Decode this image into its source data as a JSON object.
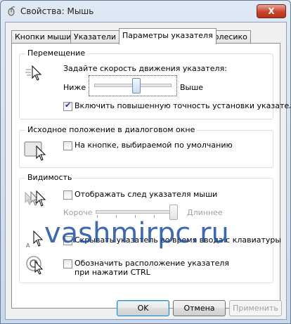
{
  "window": {
    "title": "Свойства: Мышь",
    "close_symbol": "X"
  },
  "tabs": [
    {
      "label": "Кнопки мыши"
    },
    {
      "label": "Указатели"
    },
    {
      "label": "Параметры указателя",
      "active": true
    },
    {
      "label": "Колесико"
    }
  ],
  "motion": {
    "group_title": "Перемещение",
    "speed_label": "Задайте скорость движения указателя:",
    "slow_label": "Ниже",
    "fast_label": "Выше",
    "speed_level": 0.55,
    "precision_label": "Включить повышенную точность установки указателя",
    "precision_checked": true
  },
  "snap": {
    "group_title": "Исходное положение в диалоговом окне",
    "snap_label": "На кнопке, выбираемой по умолчанию",
    "snap_checked": false
  },
  "visibility": {
    "group_title": "Видимость",
    "trails_label": "Отображать след указателя мыши",
    "trails_checked": false,
    "short_label": "Короче",
    "long_label": "Длиннее",
    "trail_level": 1.0,
    "hide_label": "Скрывать указатель во время ввода с клавиатуры",
    "hide_checked": false,
    "ctrl_label": "Обозначить расположение указателя при нажатии CTRL",
    "ctrl_checked": false
  },
  "watermark": "vashmirpc.ru",
  "buttons": {
    "ok": "OK",
    "cancel": "Отмена",
    "apply": "Применить"
  },
  "colors": {
    "accent": "#3c7fb1",
    "watermark": "#1b4fa8",
    "close": "#c9442c"
  }
}
